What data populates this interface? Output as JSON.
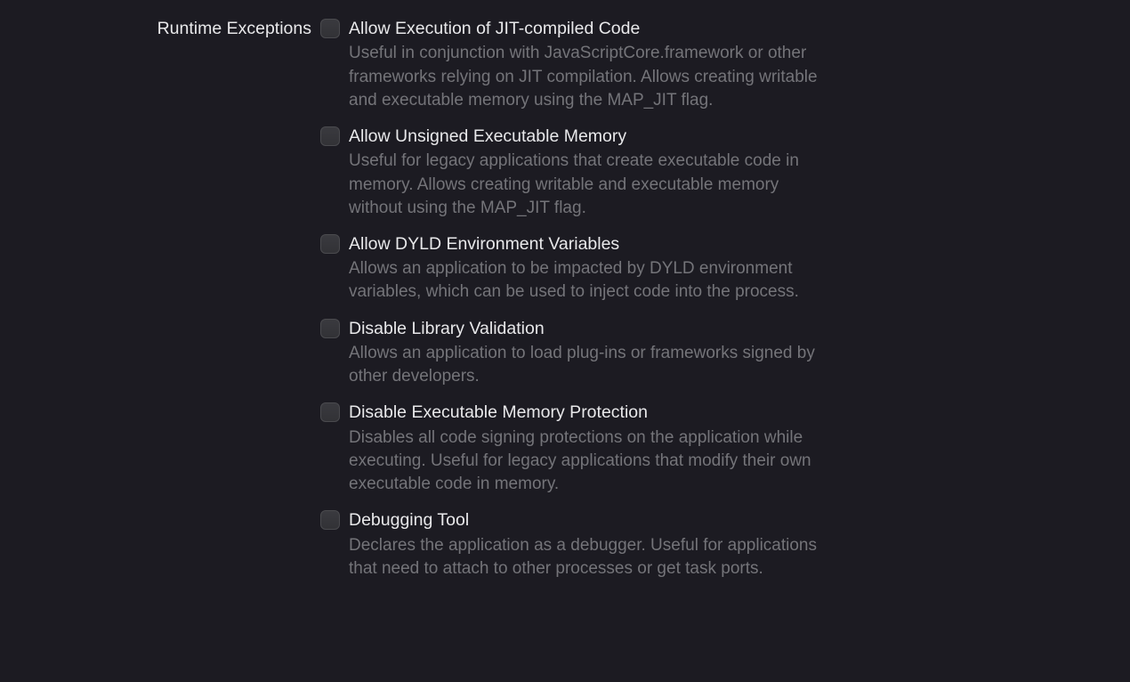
{
  "section_label": "Runtime Exceptions",
  "options": [
    {
      "title": "Allow Execution of JIT-compiled Code",
      "desc": "Useful in conjunction with JavaScriptCore.framework or other frameworks relying on JIT compilation. Allows creating writable and executable memory using the MAP_JIT flag."
    },
    {
      "title": "Allow Unsigned Executable Memory",
      "desc": "Useful for legacy applications that create executable code in memory. Allows creating writable and executable memory without using the MAP_JIT flag."
    },
    {
      "title": "Allow DYLD Environment Variables",
      "desc": "Allows an application to be impacted by DYLD environment variables, which can be used to inject code into the process."
    },
    {
      "title": "Disable Library Validation",
      "desc": "Allows an application to load plug-ins or frameworks signed by other developers."
    },
    {
      "title": "Disable Executable Memory Protection",
      "desc": "Disables all code signing protections on the application while executing. Useful for legacy applications that modify their own executable code in memory."
    },
    {
      "title": "Debugging Tool",
      "desc": "Declares the application as a debugger. Useful for applications that need to attach to other processes or get task ports."
    }
  ]
}
